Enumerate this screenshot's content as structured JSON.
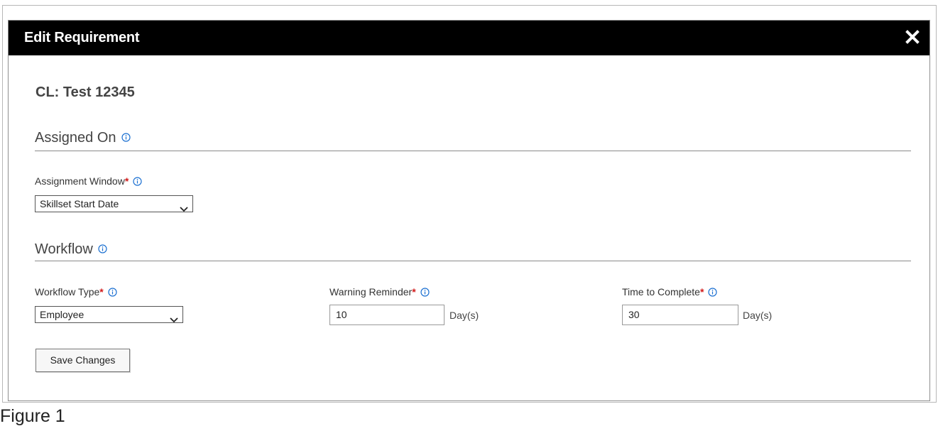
{
  "modal": {
    "title": "Edit Requirement",
    "requirement_name": "CL: Test 12345"
  },
  "assigned_on": {
    "heading": "Assigned On",
    "assignment_window": {
      "label": "Assignment Window",
      "required_marker": "*",
      "selected": "Skillset Start Date"
    }
  },
  "workflow": {
    "heading": "Workflow",
    "workflow_type": {
      "label": "Workflow Type",
      "required_marker": "*",
      "selected": "Employee"
    },
    "warning_reminder": {
      "label": "Warning Reminder",
      "required_marker": "*",
      "value": "10",
      "unit": "Day(s)"
    },
    "time_to_complete": {
      "label": "Time to Complete",
      "required_marker": "*",
      "value": "30",
      "unit": "Day(s)"
    }
  },
  "actions": {
    "save_label": "Save Changes"
  },
  "caption": "Figure 1",
  "colors": {
    "header_bg": "#000000",
    "required": "#d11a1a",
    "info_icon": "#1a6fd1"
  }
}
